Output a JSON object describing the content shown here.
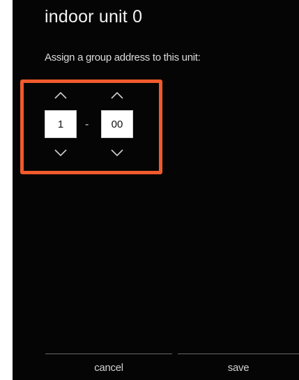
{
  "header": {
    "title": "indoor unit 0"
  },
  "prompt": {
    "text": "Assign a group address to this unit:"
  },
  "address": {
    "group": "1",
    "separator": "-",
    "unit": "00"
  },
  "icons": {
    "increment": "chevron-up-icon",
    "decrement": "chevron-down-icon"
  },
  "footer": {
    "cancel_label": "cancel",
    "save_label": "save"
  },
  "colors": {
    "background": "#050505",
    "highlight": "#f05a2c",
    "text": "#f2f2f2"
  }
}
